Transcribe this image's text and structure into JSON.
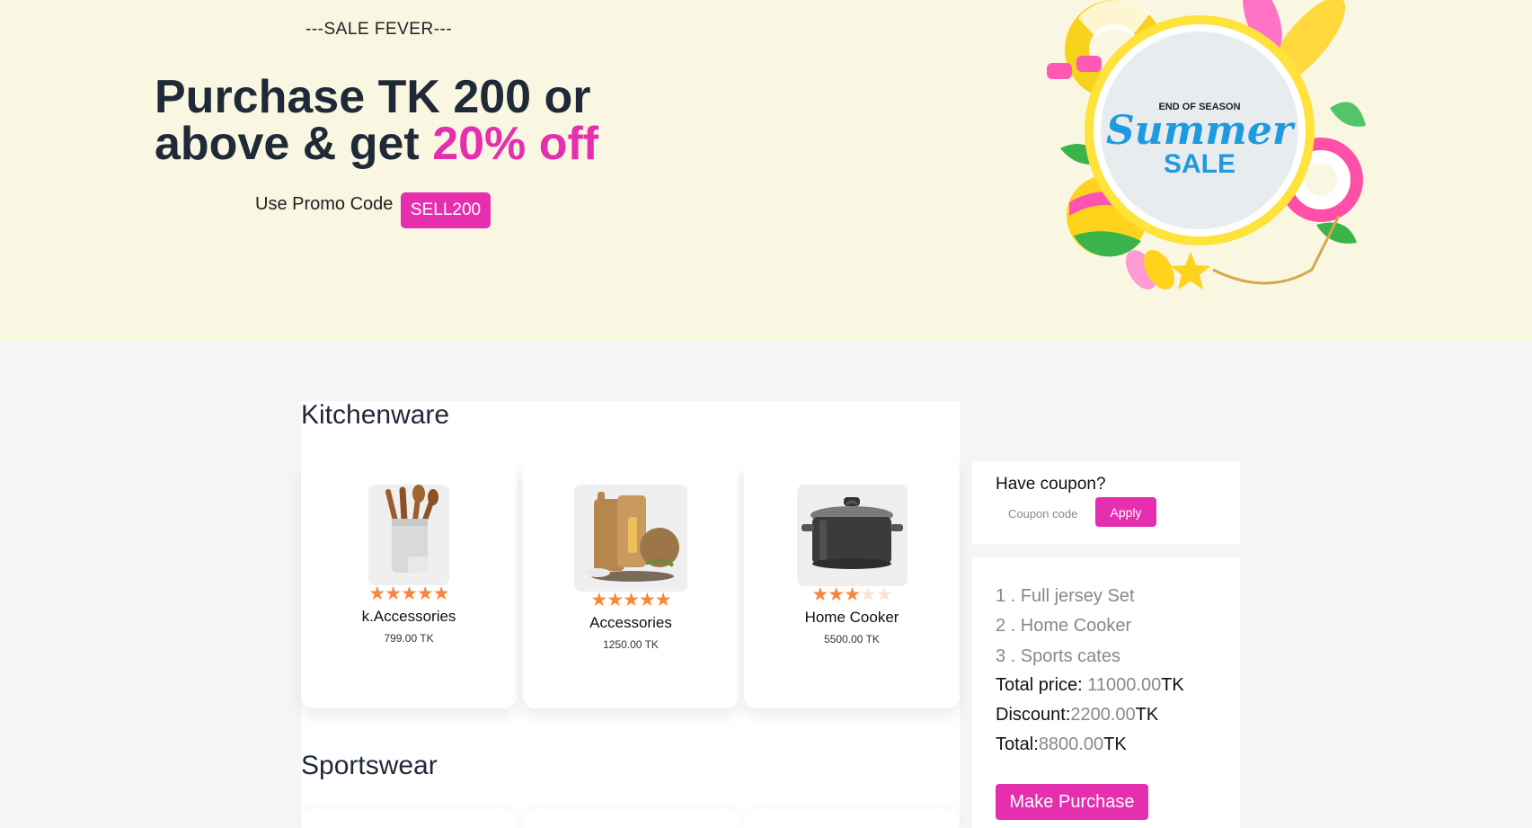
{
  "hero": {
    "tagline": "---SALE FEVER---",
    "headline_line1": "Purchase TK 200 or",
    "headline_line2_prefix": "above & get ",
    "headline_accent": "20% off",
    "promo_label": "Use Promo Code",
    "promo_code": "SELL200",
    "badge_top": "END OF SEASON",
    "badge_script": "Summer",
    "badge_bottom": "SALE"
  },
  "sections": [
    {
      "title": "Kitchenware",
      "products": [
        {
          "name": "k.Accessories",
          "price": "799.00 TK",
          "rating": 5,
          "image_icon": "utensil-holder-icon"
        },
        {
          "name": "Accessories",
          "price": "1250.00 TK",
          "rating": 5,
          "image_icon": "cutting-board-icon"
        },
        {
          "name": "Home Cooker",
          "price": "5500.00 TK",
          "rating": 3,
          "image_icon": "cooking-pot-icon"
        }
      ]
    },
    {
      "title": "Sportswear",
      "products": []
    }
  ],
  "coupon": {
    "title": "Have coupon?",
    "placeholder": "Coupon code",
    "apply_label": "Apply"
  },
  "cart": {
    "items": [
      "1 . Full jersey Set",
      "2 . Home Cooker",
      "3 . Sports cates"
    ],
    "total_price_label": "Total price: ",
    "total_price_value": "11000.00",
    "discount_label": "Discount:",
    "discount_value": "2200.00",
    "total_label": "Total:",
    "total_value": "8800.00",
    "currency": "TK",
    "purchase_label": "Make Purchase"
  },
  "colors": {
    "accent": "#e52fae",
    "star": "#f5883a",
    "hero_bg": "#f9f7e1"
  }
}
